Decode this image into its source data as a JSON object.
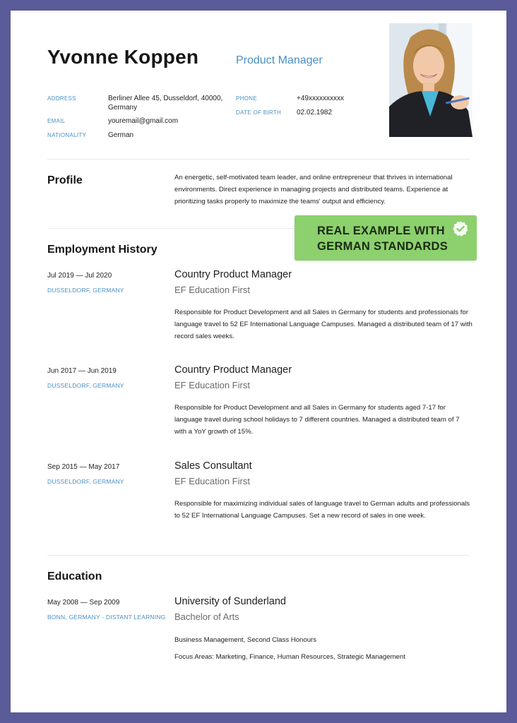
{
  "header": {
    "name": "Yvonne Koppen",
    "job_title": "Product Manager"
  },
  "details": {
    "address_label": "ADDRESS",
    "address_value": "Berliner Allee 45, Dusseldorf, 40000, Germany",
    "email_label": "EMAIL",
    "email_value": "youremail@gmail.com",
    "nationality_label": "NATIONALITY",
    "nationality_value": "German",
    "phone_label": "PHONE",
    "phone_value": "+49xxxxxxxxxx",
    "dob_label": "DATE OF BIRTH",
    "dob_value": "02.02.1982"
  },
  "profile": {
    "title": "Profile",
    "text": "An energetic, self-motivated team leader, and online entrepreneur that thrives in international environments. Direct experience in managing projects and distributed teams. Experience at prioritizing tasks properly to maximize the teams' output and efficiency."
  },
  "employment": {
    "title": "Employment History",
    "items": [
      {
        "dates": "Jul 2019 — Jul 2020",
        "location": "DUSSELDORF, GERMANY",
        "role": "Country Product Manager",
        "org": "EF Education First",
        "description": "Responsible for Product Development and all Sales in Germany for students and professionals for language travel to 52 EF International Language Campuses. Managed a distributed team of 17 with record sales weeks."
      },
      {
        "dates": "Jun 2017 — Jun 2019",
        "location": "DUSSELDORF, GERMANY",
        "role": "Country Product Manager",
        "org": "EF Education First",
        "description": "Responsible for Product Development and all Sales in Germany for students aged 7-17  for language travel during school holidays to 7 different countries. Managed a distributed team of 7 with a YoY growth of 15%."
      },
      {
        "dates": "Sep 2015 — May 2017",
        "location": "DUSSELDORF, GERMANY",
        "role": "Sales Consultant",
        "org": "EF Education First",
        "description": "Responsible for maximizing individual sales of language travel to German adults and professionals to 52 EF International Language Campuses. Set a new record of sales in one week."
      }
    ]
  },
  "education": {
    "title": "Education",
    "dates": "May 2008 — Sep 2009",
    "location": "BONN, GERMANY - DISTANT LEARNING",
    "school": "University of Sunderland",
    "degree": "Bachelor of Arts",
    "line1": "Business Management, Second Class Honours",
    "line2": "Focus Areas: Marketing, Finance, Human Resources, Strategic Management"
  },
  "badge": {
    "line1": "REAL EXAMPLE WITH",
    "line2": "GERMAN STANDARDS",
    "icon": "check-circle-icon",
    "color": "#8dd06e"
  },
  "colors": {
    "background": "#5a5b98",
    "accent": "#4a8fc4"
  }
}
